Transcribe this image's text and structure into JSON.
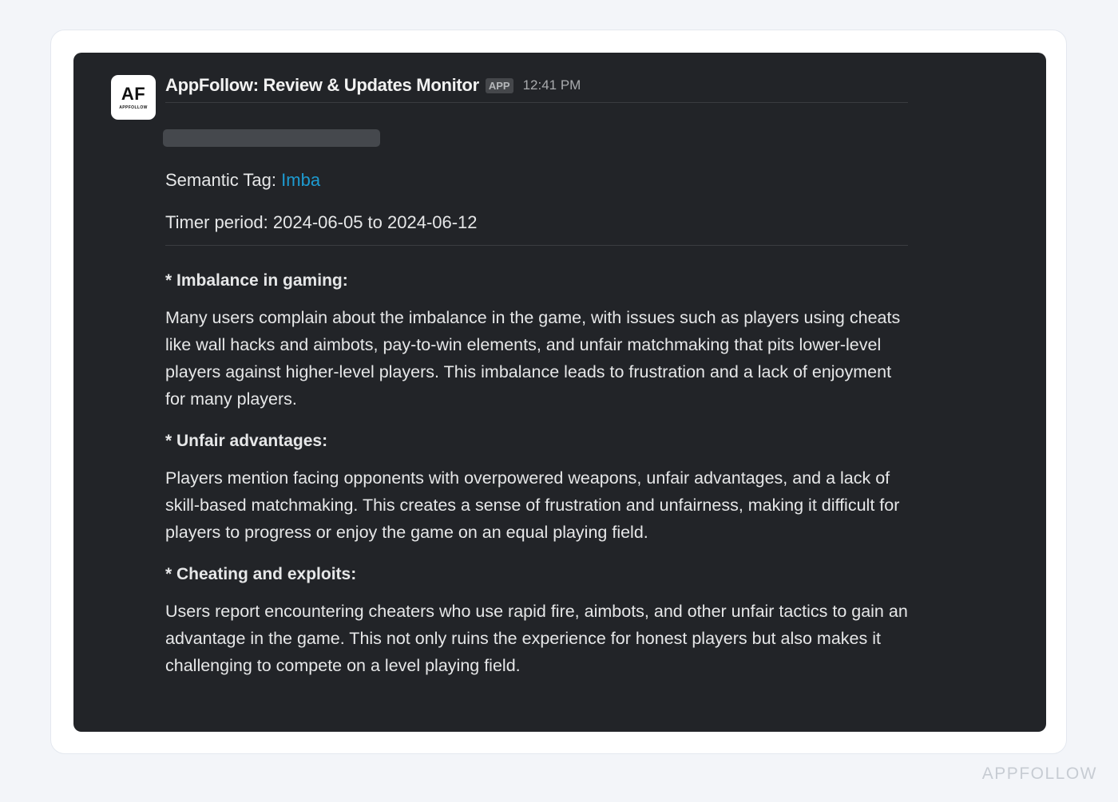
{
  "avatar": {
    "initials": "AF",
    "brand": "APPFOLLOW"
  },
  "message": {
    "sender": "AppFollow: Review & Updates Monitor",
    "badge": "APP",
    "time": "12:41 PM",
    "semantic_tag_label": "Semantic Tag:",
    "semantic_tag_value": "Imba",
    "timer_period": "Timer period: 2024-06-05 to 2024-06-12",
    "sections": [
      {
        "title": "* Imbalance in gaming:",
        "body": "Many users complain about the imbalance in the game, with issues such as players using cheats like wall hacks and aimbots, pay-to-win elements, and unfair matchmaking that pits lower-level players against higher-level players. This imbalance leads to frustration and a lack of enjoyment for many players."
      },
      {
        "title": "* Unfair advantages:",
        "body": "Players mention facing opponents with overpowered weapons, unfair advantages, and a lack of skill-based matchmaking. This creates a sense of frustration and unfairness, making it difficult for players to progress or enjoy the game on an equal playing field."
      },
      {
        "title": "* Cheating and exploits:",
        "body": "Users report encountering cheaters who use rapid fire, aimbots, and other unfair tactics to gain an advantage in the game. This not only ruins the experience for honest players but also makes it challenging to compete on a level playing field."
      }
    ]
  },
  "watermark": "APPFOLLOW",
  "colors": {
    "link": "#1d9bd1",
    "panel": "#222428",
    "page": "#f3f5f9"
  }
}
